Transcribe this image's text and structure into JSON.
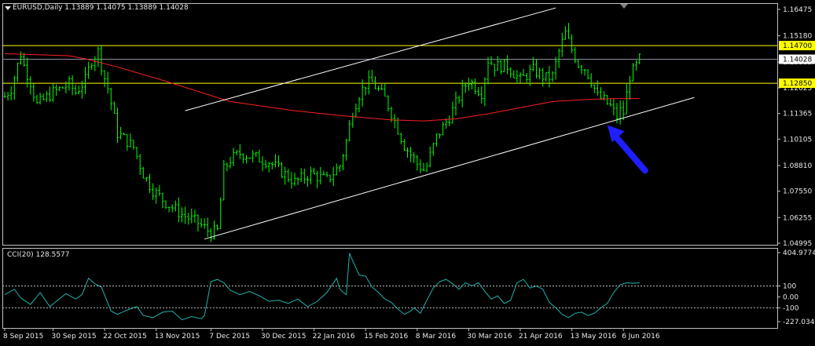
{
  "header": {
    "symbol": "EURUSD,Daily",
    "ohlc": "1.13889 1.14075 1.13889 1.14028"
  },
  "cci_panel": {
    "title": "CCI(20) 128.5577",
    "scale_labels": [
      "404.9774",
      "100",
      "0.00",
      "-100",
      "-227.0348"
    ],
    "levels": [
      100,
      -100
    ],
    "ylim": [
      -227.0348,
      404.9774
    ]
  },
  "colors": {
    "background": "#000000",
    "candles": "#00ff00",
    "moving_average": "#ff2020",
    "horizontal_levels": "#ffff00",
    "price_line": "#8a8aa0",
    "channel_lines": "#ffffff",
    "cci_line": "#20b2aa",
    "arrow": "#1e1eff",
    "price_tag_yellow": "#ffff00",
    "price_tag_current": "#ffffff"
  },
  "chart_data": {
    "type": "candlestick",
    "symbol": "EURUSD",
    "timeframe": "Daily",
    "ylim": [
      1.04995,
      1.16475
    ],
    "y_ticks": [
      "1.16475",
      "1.15180",
      "1.13885",
      "1.12625",
      "1.11365",
      "1.10105",
      "1.08810",
      "1.07550",
      "1.06255",
      "1.04995"
    ],
    "x_ticks": [
      "8 Sep 2015",
      "30 Sep 2015",
      "22 Oct 2015",
      "13 Nov 2015",
      "7 Dec 2015",
      "30 Dec 2015",
      "22 Jan 2016",
      "15 Feb 2016",
      "8 Mar 2016",
      "30 Mar 2016",
      "21 Apr 2016",
      "13 May 2016",
      "6 Jun 2016"
    ],
    "horizontal_levels": [
      {
        "value": 1.147,
        "label": "1.14700"
      },
      {
        "value": 1.1285,
        "label": "1.12850"
      }
    ],
    "current_price": {
      "value": 1.14028,
      "label": "1.14028"
    },
    "close_anchors": {
      "x": [
        0,
        2,
        5,
        6,
        8,
        10,
        15,
        20,
        22,
        25,
        27,
        29,
        31,
        32,
        35,
        38,
        40,
        43,
        46,
        50,
        55,
        60,
        64,
        66,
        68,
        70,
        73,
        78,
        82,
        86,
        90,
        95,
        100,
        104,
        106,
        108,
        110,
        112,
        114,
        118,
        120,
        124,
        128,
        130,
        131,
        132,
        134,
        138,
        142,
        144,
        148,
        150,
        152,
        156,
        160,
        164,
        168,
        170,
        172,
        174,
        176,
        178,
        180,
        182,
        184,
        186,
        188,
        190,
        191,
        192,
        194,
        196,
        197
      ],
      "close": [
        1.122,
        1.126,
        1.143,
        1.137,
        1.129,
        1.118,
        1.124,
        1.128,
        1.124,
        1.13,
        1.14,
        1.144,
        1.131,
        1.126,
        1.104,
        1.1,
        1.097,
        1.084,
        1.076,
        1.07,
        1.064,
        1.06,
        1.055,
        1.056,
        1.086,
        1.091,
        1.094,
        1.092,
        1.09,
        1.085,
        1.08,
        1.084,
        1.081,
        1.088,
        1.1,
        1.115,
        1.123,
        1.128,
        1.129,
        1.121,
        1.114,
        1.098,
        1.089,
        1.086,
        1.088,
        1.093,
        1.102,
        1.112,
        1.125,
        1.13,
        1.124,
        1.14,
        1.137,
        1.137,
        1.13,
        1.135,
        1.131,
        1.132,
        1.144,
        1.153,
        1.145,
        1.138,
        1.136,
        1.13,
        1.122,
        1.12,
        1.117,
        1.112,
        1.115,
        1.114,
        1.132,
        1.137,
        1.1403
      ]
    },
    "moving_average": {
      "x": [
        0,
        20,
        25,
        35,
        50,
        70,
        90,
        105,
        120,
        130,
        140,
        150,
        160,
        170,
        180,
        190,
        197
      ],
      "y": [
        1.143,
        1.142,
        1.1405,
        1.1365,
        1.1295,
        1.1195,
        1.115,
        1.1125,
        1.1105,
        1.11,
        1.111,
        1.1135,
        1.1165,
        1.1195,
        1.1205,
        1.121,
        1.121
      ]
    },
    "channel": {
      "lower": {
        "x": [
          62,
          214
        ],
        "y": [
          1.052,
          1.1215
        ]
      },
      "upper": {
        "x": [
          56,
          171
        ],
        "y": [
          1.115,
          1.1655
        ]
      }
    },
    "cci": {
      "x": [
        0,
        3,
        5,
        8,
        11,
        14,
        16,
        19,
        22,
        24,
        26,
        28,
        30,
        33,
        35,
        38,
        41,
        43,
        46,
        49,
        52,
        55,
        58,
        61,
        62,
        64,
        66,
        68,
        70,
        73,
        76,
        79,
        82,
        85,
        88,
        91,
        94,
        97,
        100,
        103,
        104,
        106,
        107,
        108,
        110,
        112,
        114,
        116,
        118,
        120,
        122,
        124,
        126,
        127,
        129,
        131,
        133,
        135,
        137,
        139,
        141,
        143,
        145,
        147,
        149,
        151,
        153,
        155,
        157,
        159,
        161,
        163,
        165,
        167,
        169,
        171,
        173,
        175,
        177,
        179,
        181,
        183,
        185,
        187,
        189,
        191,
        193,
        195,
        197
      ],
      "y": [
        20,
        70,
        -10,
        -70,
        40,
        -90,
        -40,
        30,
        -20,
        20,
        170,
        120,
        90,
        -130,
        -160,
        -120,
        -90,
        -170,
        -190,
        -140,
        -130,
        -210,
        -180,
        -200,
        -170,
        140,
        160,
        130,
        60,
        20,
        50,
        10,
        -40,
        -30,
        -60,
        -20,
        -90,
        -40,
        40,
        170,
        70,
        20,
        400,
        330,
        200,
        190,
        90,
        40,
        -20,
        -50,
        -110,
        -160,
        -130,
        -100,
        -150,
        -30,
        80,
        140,
        160,
        120,
        70,
        130,
        100,
        130,
        50,
        -20,
        10,
        -60,
        -30,
        130,
        160,
        80,
        100,
        70,
        -50,
        -100,
        -160,
        -190,
        -150,
        -140,
        -170,
        -150,
        -100,
        -60,
        40,
        110,
        128.56,
        125,
        128.56
      ]
    }
  }
}
